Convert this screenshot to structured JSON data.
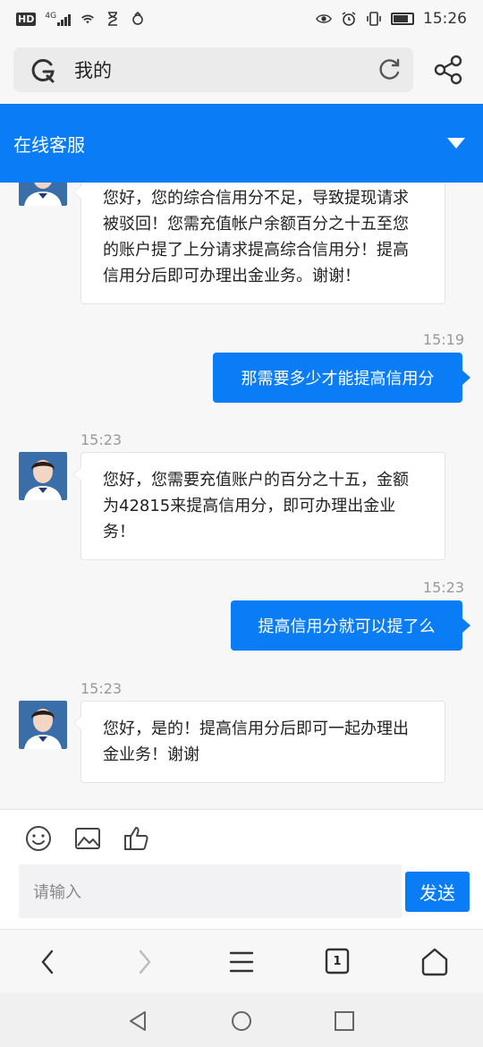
{
  "status_bar": {
    "left_icons": [
      "hd-icon",
      "signal-4g-icon",
      "wifi-icon",
      "hourglass-icon",
      "app-icon"
    ],
    "hd_label": "HD",
    "network_label": "4G",
    "right_icons": [
      "eye-icon",
      "alarm-icon",
      "vibrate-icon",
      "battery-icon"
    ],
    "time": "15:26",
    "battery_level": 0.8
  },
  "search": {
    "text": "我的"
  },
  "header": {
    "title": "在线客服"
  },
  "messages": [
    {
      "side": "left",
      "timestamp": "",
      "text": "您好，您的综合信用分不足，导致提现请求被驳回！您需充值帐户余额百分之十五至您的账户提了上分请求提高综合信用分！提高信用分后即可办理出金业务。谢谢！"
    },
    {
      "side": "right",
      "timestamp": "15:19",
      "text": "那需要多少才能提高信用分"
    },
    {
      "side": "left",
      "timestamp": "15:23",
      "text": "您好，您需要充值账户的百分之十五，金额为42815来提高信用分，即可办理出金业务！"
    },
    {
      "side": "right",
      "timestamp": "15:23",
      "text": "提高信用分就可以提了么"
    },
    {
      "side": "left",
      "timestamp": "15:23",
      "text": "您好，是的！提高信用分后即可一起办理出金业务！谢谢"
    }
  ],
  "input": {
    "placeholder": "请输入",
    "send_label": "发送"
  },
  "nav": {
    "tab_count": "1"
  },
  "colors": {
    "accent": "#0a7cf5",
    "background": "#f7f7f7"
  }
}
